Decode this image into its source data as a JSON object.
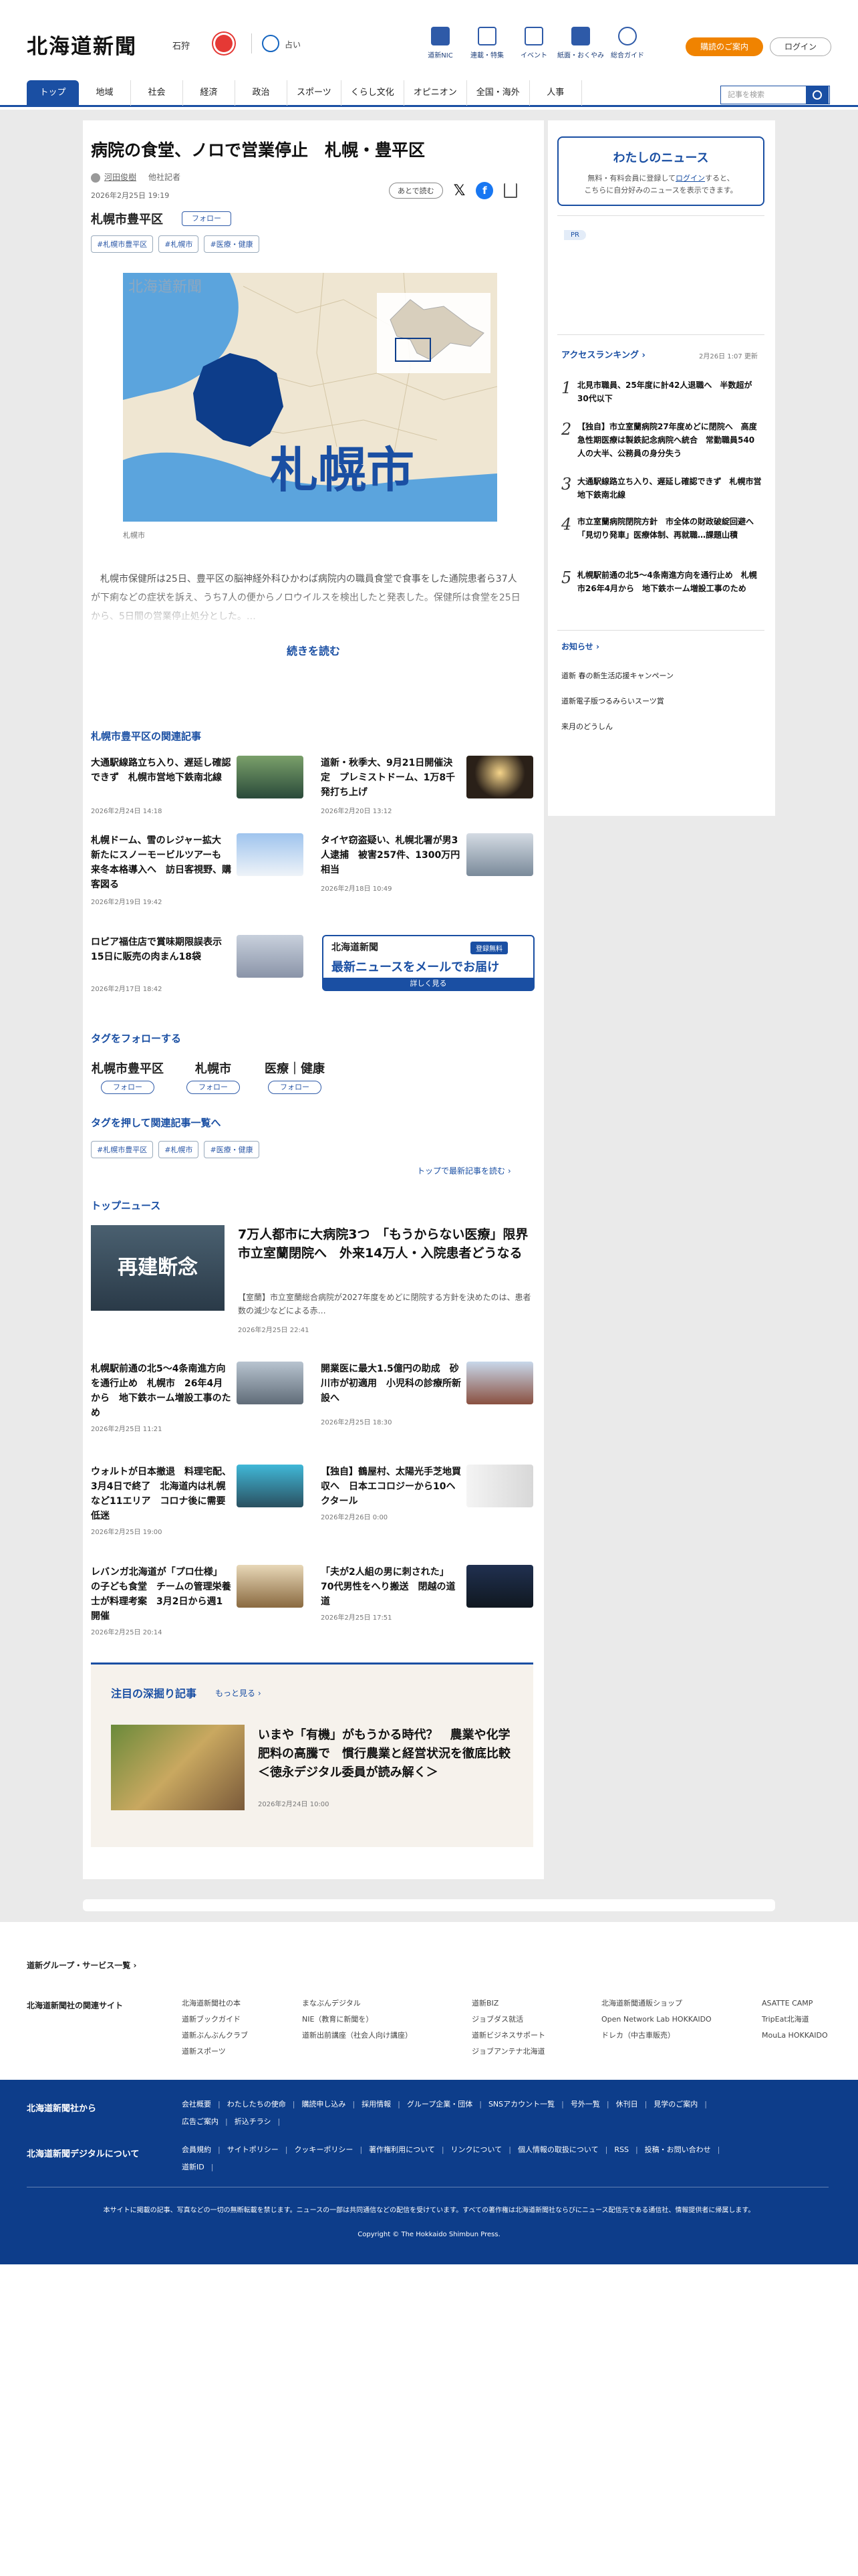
{
  "header": {
    "logo": "北海道新聞",
    "location": "石狩",
    "fortune_label": "占い",
    "nav": [
      "道新NIC",
      "連載・特集",
      "イベント",
      "紙面・おくやみ",
      "総合ガイド"
    ],
    "subscribe": "購読のご案内",
    "login": "ログイン"
  },
  "gnav": {
    "tabs": [
      "トップ",
      "地域",
      "社会",
      "経済",
      "政治",
      "スポーツ",
      "くらし文化",
      "オピニオン",
      "全国・海外",
      "人事"
    ],
    "search_placeholder": "記事を検索"
  },
  "article": {
    "title": "病院の食堂、ノロで営業停止　札幌・豊平区",
    "author": "河田俊樹",
    "author_link": "他社記者",
    "date": "2026年2月25日 19:19",
    "later": "あとで読む",
    "area": "札幌市豊平区",
    "follow": "フォロー",
    "tags": [
      "#札幌市豊平区",
      "#札幌市",
      "#医療・健康"
    ],
    "map_caption": "札幌市",
    "map_label": "札幌市",
    "map_logo": "北海道新聞",
    "lead": "　札幌市保健所は25日、豊平区の脳神経外科ひかわば病院内の職員食堂で食事をした通院患者ら37人が下痢などの症状を訴え、うち7人の便からノロウイルスを検出したと発表した。保健所は食堂を25日から、5日間の営業停止処分とした。…",
    "more": "続きを読む"
  },
  "related": {
    "heading": "札幌市豊平区の関連記事",
    "items": [
      {
        "title": "大通駅線路立ち入り、遅延し確認できず　札幌市営地下鉄南北線",
        "date": "2026年2月24日 14:18"
      },
      {
        "title": "道新・秋季大、9月21日開催決定　プレミストドーム、1万8千発打ち上げ",
        "date": "2026年2月20日 13:12"
      },
      {
        "title": "札幌ドーム、雪のレジャー拡大　新たにスノーモービルツアーも　来冬本格導入へ　訪日客視野、購客図る",
        "date": "2026年2月19日 19:42"
      },
      {
        "title": "タイヤ窃盗疑い、札幌北署が男3人逮捕　被害257件、1300万円相当",
        "date": "2026年2月18日 10:49"
      },
      {
        "title": "ロピア福住店で賞味期限誤表示　15日に販売の肉まん18袋",
        "date": "2026年2月17日 18:42"
      }
    ]
  },
  "mailad": {
    "logo": "北海道新聞",
    "free": "登録無料",
    "title": "最新ニュースをメールでお届け",
    "detail": "詳しく見る"
  },
  "follow_tags": {
    "heading": "タグをフォローする",
    "items": [
      "札幌市豊平区",
      "札幌市",
      "医療｜健康"
    ],
    "button": "フォロー"
  },
  "tag_links": {
    "heading": "タグを押して関連記事一覧へ",
    "items": [
      "#札幌市豊平区",
      "#札幌市",
      "#医療・健康"
    ],
    "top_link": "トップで最新記事を読む"
  },
  "topnews": {
    "heading": "トップニュース",
    "main": {
      "img": "再建断念",
      "title": "7万人都市に大病院3つ　「もうからない医療」限界　市立室蘭閉院へ　外来14万人・入院患者どうなる",
      "summary": "【室蘭】市立室蘭総合病院が2027年度をめどに閉院する方針を決めたのは、患者数の減少などによる赤…",
      "date": "2026年2月25日 22:41"
    },
    "items": [
      {
        "title": "札幌駅前通の北5〜4条南進方向を通行止め　札幌市　26年4月から　地下鉄ホーム増設工事のため",
        "date": "2026年2月25日 11:21"
      },
      {
        "title": "開業医に最大1.5億円の助成　砂川市が初適用　小児科の診療所新設へ",
        "date": "2026年2月25日 18:30"
      },
      {
        "title": "ウォルトが日本撤退　料理宅配、3月4日で終了　北海道内は札幌など11エリア　コロナ後に需要低迷",
        "date": "2026年2月25日 19:00"
      },
      {
        "title": "【独自】鶴屋村、太陽光手芝地買収へ　日本エコロジーから10ヘクタール",
        "date": "2026年2月26日 0:00"
      },
      {
        "title": "レバンガ北海道が「プロ仕様」の子ども食堂　チームの管理栄養士が料理考案　3月2日から週1開催",
        "date": "2026年2月25日 20:14"
      },
      {
        "title": "「夫が2人組の男に刺された」　70代男性をへり搬送　閉越の道道",
        "date": "2026年2月25日 17:51"
      }
    ]
  },
  "deep": {
    "heading": "注目の深掘り記事",
    "more": "もっと見る",
    "title": "いまや「有機」がもうかる時代？　農業や化学肥料の高騰で　慣行農業と経営状況を徹底比較＜徳永デジタル委員が読み解く＞",
    "date": "2026年2月24日 10:00"
  },
  "sidebar": {
    "mynews_title": "わたしのニュース",
    "mynews_text1": "無料・有料会員に登録して",
    "mynews_login": "ログイン",
    "mynews_text2": "すると、",
    "mynews_text3": "こちらに自分好みのニュースを表示できます。",
    "pr": "PR",
    "ranking_title": "アクセスランキング",
    "ranking_date": "2月26日 1:07 更新",
    "ranking": [
      {
        "n": "1",
        "t": "北見市職員、25年度に計42人退職へ　半数超が30代以下"
      },
      {
        "n": "2",
        "t": "【独自】市立室蘭病院27年度めどに閉院へ　高度急性期医療は製鉄記念病院へ統合　常勤職員540人の大半、公務員の身分失う"
      },
      {
        "n": "3",
        "t": "大通駅線路立ち入り、遅延し確認できず　札幌市営地下鉄南北線"
      },
      {
        "n": "4",
        "t": "市立室蘭病院閉院方針　市全体の財政破綻回避へ「見切り発車」医療体制、再就職…課題山積"
      },
      {
        "n": "5",
        "t": "札幌駅前通の北5〜4条南進方向を通行止め　札幌市26年4月から　地下鉄ホーム増設工事のため"
      }
    ],
    "notice_title": "お知らせ",
    "notices": [
      "道新 春の新生活応援キャンペーン",
      "道新電子版つるみらいスーツ賞",
      "来月のどうしん"
    ]
  },
  "footer": {
    "group": "道新グループ・サービス一覧",
    "related_sites": "北海道新聞社の関連サイト",
    "cols": [
      [
        "北海道新聞社の本",
        "道新ブックガイド",
        "道新ぶんぶんクラブ",
        "道新スポーツ"
      ],
      [
        "まなぶんデジタル",
        "NIE（教育に新聞を）",
        "道新出前講座（社会人向け講座）"
      ],
      [
        "道新BIZ",
        "ジョブダス就活",
        "道新ビジネスサポート",
        "ジョブアンテナ北海道"
      ],
      [
        "北海道新聞通販ショップ",
        "Open Network Lab HOKKAIDO",
        "ドレカ（中古車販売）"
      ],
      [
        "ASATTE CAMP",
        "TripEat北海道",
        "MouLa HOKKAIDO"
      ]
    ],
    "about_label": "北海道新聞社から",
    "about_links": [
      "会社概要",
      "わたしたちの使命",
      "購読申し込み",
      "採用情報",
      "グループ企業・団体",
      "SNSアカウント一覧",
      "号外一覧",
      "休刊日",
      "見学のご案内",
      "広告ご案内",
      "折込チラシ"
    ],
    "digital_label": "北海道新聞デジタルについて",
    "digital_links": [
      "会員規約",
      "サイトポリシー",
      "クッキーポリシー",
      "著作権利用について",
      "リンクについて",
      "個人情報の取扱について",
      "RSS",
      "投稿・お問い合わせ",
      "道新ID"
    ],
    "note": "本サイトに掲載の記事、写真などの一切の無断転載を禁じます。ニュースの一部は共同通信などの配信を受けています。すべての著作権は北海道新聞社ならびにニュース配信元である通信社、情報提供者に帰属します。",
    "copyright": "Copyright © The Hokkaido Shimbun Press."
  },
  "colors": {
    "brand": "#1a4fa3",
    "accent": "#f08300"
  }
}
